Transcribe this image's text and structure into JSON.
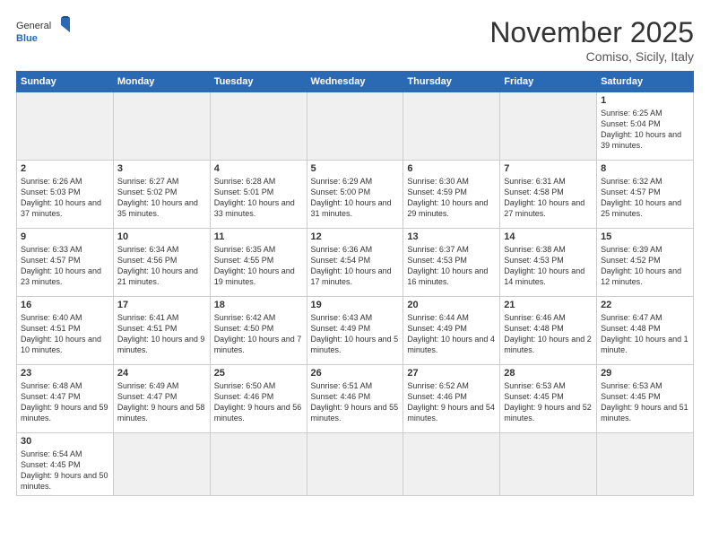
{
  "header": {
    "logo": {
      "general": "General",
      "blue": "Blue"
    },
    "title": "November 2025",
    "subtitle": "Comiso, Sicily, Italy"
  },
  "weekdays": [
    "Sunday",
    "Monday",
    "Tuesday",
    "Wednesday",
    "Thursday",
    "Friday",
    "Saturday"
  ],
  "weeks": [
    [
      {
        "day": "",
        "info": "",
        "empty": true
      },
      {
        "day": "",
        "info": "",
        "empty": true
      },
      {
        "day": "",
        "info": "",
        "empty": true
      },
      {
        "day": "",
        "info": "",
        "empty": true
      },
      {
        "day": "",
        "info": "",
        "empty": true
      },
      {
        "day": "",
        "info": "",
        "empty": true
      },
      {
        "day": "1",
        "info": "Sunrise: 6:25 AM\nSunset: 5:04 PM\nDaylight: 10 hours and 39 minutes."
      }
    ],
    [
      {
        "day": "2",
        "info": "Sunrise: 6:26 AM\nSunset: 5:03 PM\nDaylight: 10 hours and 37 minutes."
      },
      {
        "day": "3",
        "info": "Sunrise: 6:27 AM\nSunset: 5:02 PM\nDaylight: 10 hours and 35 minutes."
      },
      {
        "day": "4",
        "info": "Sunrise: 6:28 AM\nSunset: 5:01 PM\nDaylight: 10 hours and 33 minutes."
      },
      {
        "day": "5",
        "info": "Sunrise: 6:29 AM\nSunset: 5:00 PM\nDaylight: 10 hours and 31 minutes."
      },
      {
        "day": "6",
        "info": "Sunrise: 6:30 AM\nSunset: 4:59 PM\nDaylight: 10 hours and 29 minutes."
      },
      {
        "day": "7",
        "info": "Sunrise: 6:31 AM\nSunset: 4:58 PM\nDaylight: 10 hours and 27 minutes."
      },
      {
        "day": "8",
        "info": "Sunrise: 6:32 AM\nSunset: 4:57 PM\nDaylight: 10 hours and 25 minutes."
      }
    ],
    [
      {
        "day": "9",
        "info": "Sunrise: 6:33 AM\nSunset: 4:57 PM\nDaylight: 10 hours and 23 minutes."
      },
      {
        "day": "10",
        "info": "Sunrise: 6:34 AM\nSunset: 4:56 PM\nDaylight: 10 hours and 21 minutes."
      },
      {
        "day": "11",
        "info": "Sunrise: 6:35 AM\nSunset: 4:55 PM\nDaylight: 10 hours and 19 minutes."
      },
      {
        "day": "12",
        "info": "Sunrise: 6:36 AM\nSunset: 4:54 PM\nDaylight: 10 hours and 17 minutes."
      },
      {
        "day": "13",
        "info": "Sunrise: 6:37 AM\nSunset: 4:53 PM\nDaylight: 10 hours and 16 minutes."
      },
      {
        "day": "14",
        "info": "Sunrise: 6:38 AM\nSunset: 4:53 PM\nDaylight: 10 hours and 14 minutes."
      },
      {
        "day": "15",
        "info": "Sunrise: 6:39 AM\nSunset: 4:52 PM\nDaylight: 10 hours and 12 minutes."
      }
    ],
    [
      {
        "day": "16",
        "info": "Sunrise: 6:40 AM\nSunset: 4:51 PM\nDaylight: 10 hours and 10 minutes."
      },
      {
        "day": "17",
        "info": "Sunrise: 6:41 AM\nSunset: 4:51 PM\nDaylight: 10 hours and 9 minutes."
      },
      {
        "day": "18",
        "info": "Sunrise: 6:42 AM\nSunset: 4:50 PM\nDaylight: 10 hours and 7 minutes."
      },
      {
        "day": "19",
        "info": "Sunrise: 6:43 AM\nSunset: 4:49 PM\nDaylight: 10 hours and 5 minutes."
      },
      {
        "day": "20",
        "info": "Sunrise: 6:44 AM\nSunset: 4:49 PM\nDaylight: 10 hours and 4 minutes."
      },
      {
        "day": "21",
        "info": "Sunrise: 6:46 AM\nSunset: 4:48 PM\nDaylight: 10 hours and 2 minutes."
      },
      {
        "day": "22",
        "info": "Sunrise: 6:47 AM\nSunset: 4:48 PM\nDaylight: 10 hours and 1 minute."
      }
    ],
    [
      {
        "day": "23",
        "info": "Sunrise: 6:48 AM\nSunset: 4:47 PM\nDaylight: 9 hours and 59 minutes."
      },
      {
        "day": "24",
        "info": "Sunrise: 6:49 AM\nSunset: 4:47 PM\nDaylight: 9 hours and 58 minutes."
      },
      {
        "day": "25",
        "info": "Sunrise: 6:50 AM\nSunset: 4:46 PM\nDaylight: 9 hours and 56 minutes."
      },
      {
        "day": "26",
        "info": "Sunrise: 6:51 AM\nSunset: 4:46 PM\nDaylight: 9 hours and 55 minutes."
      },
      {
        "day": "27",
        "info": "Sunrise: 6:52 AM\nSunset: 4:46 PM\nDaylight: 9 hours and 54 minutes."
      },
      {
        "day": "28",
        "info": "Sunrise: 6:53 AM\nSunset: 4:45 PM\nDaylight: 9 hours and 52 minutes."
      },
      {
        "day": "29",
        "info": "Sunrise: 6:53 AM\nSunset: 4:45 PM\nDaylight: 9 hours and 51 minutes."
      }
    ],
    [
      {
        "day": "30",
        "info": "Sunrise: 6:54 AM\nSunset: 4:45 PM\nDaylight: 9 hours and 50 minutes."
      },
      {
        "day": "",
        "info": "",
        "empty": true
      },
      {
        "day": "",
        "info": "",
        "empty": true
      },
      {
        "day": "",
        "info": "",
        "empty": true
      },
      {
        "day": "",
        "info": "",
        "empty": true
      },
      {
        "day": "",
        "info": "",
        "empty": true
      },
      {
        "day": "",
        "info": "",
        "empty": true
      }
    ]
  ]
}
